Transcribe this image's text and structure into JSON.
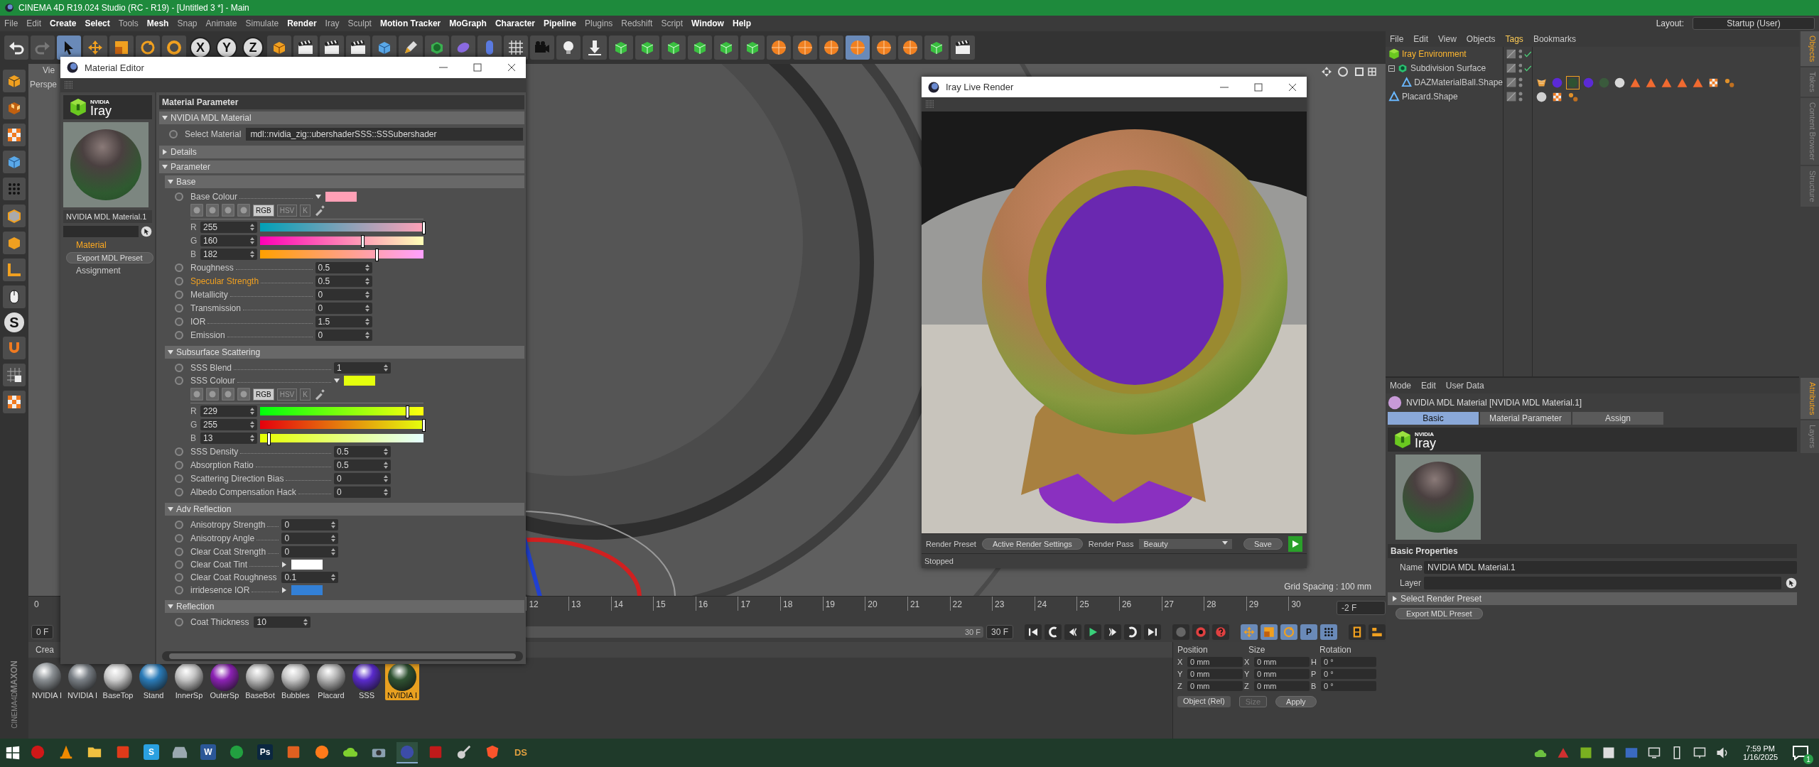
{
  "app": {
    "title": "CINEMA 4D R19.024 Studio (RC - R19) - [Untitled 3 *] - Main"
  },
  "menu": [
    {
      "label": "File",
      "emphasized": false
    },
    {
      "label": "Edit",
      "emphasized": false
    },
    {
      "label": "Create",
      "emphasized": true
    },
    {
      "label": "Select",
      "emphasized": true
    },
    {
      "label": "Tools",
      "emphasized": false
    },
    {
      "label": "Mesh",
      "emphasized": true
    },
    {
      "label": "Snap",
      "emphasized": false
    },
    {
      "label": "Animate",
      "emphasized": false
    },
    {
      "label": "Simulate",
      "emphasized": false
    },
    {
      "label": "Render",
      "emphasized": true
    },
    {
      "label": "Iray",
      "emphasized": false
    },
    {
      "label": "Sculpt",
      "emphasized": false
    },
    {
      "label": "Motion Tracker",
      "emphasized": true
    },
    {
      "label": "MoGraph",
      "emphasized": true
    },
    {
      "label": "Character",
      "emphasized": true
    },
    {
      "label": "Pipeline",
      "emphasized": true
    },
    {
      "label": "Plugins",
      "emphasized": false
    },
    {
      "label": "Redshift",
      "emphasized": false
    },
    {
      "label": "Script",
      "emphasized": false
    },
    {
      "label": "Window",
      "emphasized": true
    },
    {
      "label": "Help",
      "emphasized": true
    }
  ],
  "layout": {
    "label": "Layout:",
    "value": "Startup (User)"
  },
  "toolbar": [
    {
      "kind": "undo",
      "selected": false
    },
    {
      "kind": "redo",
      "selected": false
    },
    {
      "kind": "pointer",
      "selected": true
    },
    {
      "kind": "move",
      "selected": false
    },
    {
      "kind": "scale",
      "selected": false
    },
    {
      "kind": "rotate",
      "selected": false
    },
    {
      "kind": "live",
      "selected": false
    },
    {
      "kind": "axis",
      "label": "X",
      "selected": false
    },
    {
      "kind": "axis",
      "label": "Y",
      "selected": false
    },
    {
      "kind": "axis",
      "label": "Z",
      "selected": false
    },
    {
      "kind": "world",
      "selected": false
    },
    {
      "kind": "clapper",
      "selected": false
    },
    {
      "kind": "clapper",
      "selected": false
    },
    {
      "kind": "clapper",
      "selected": false
    },
    {
      "kind": "cube",
      "selected": false
    },
    {
      "kind": "pen",
      "selected": false
    },
    {
      "kind": "subdiv",
      "selected": false
    },
    {
      "kind": "deform",
      "selected": false
    },
    {
      "kind": "capsule",
      "selected": false
    },
    {
      "kind": "grid",
      "selected": false
    },
    {
      "kind": "camera",
      "selected": false
    },
    {
      "kind": "light",
      "selected": false
    },
    {
      "kind": "floor",
      "selected": false
    },
    {
      "kind": "greencube",
      "selected": false
    },
    {
      "kind": "greencube",
      "selected": false
    },
    {
      "kind": "greencube",
      "selected": false
    },
    {
      "kind": "greencube",
      "selected": false
    },
    {
      "kind": "greencube",
      "selected": false
    },
    {
      "kind": "greencube",
      "selected": false
    },
    {
      "kind": "orangesphere",
      "selected": false
    },
    {
      "kind": "orangesphere",
      "selected": false
    },
    {
      "kind": "orangesphere",
      "selected": false
    },
    {
      "kind": "orangesphere",
      "selected": true
    },
    {
      "kind": "orangesphere",
      "selected": false
    },
    {
      "kind": "orangesphere",
      "selected": false
    },
    {
      "kind": "greencube",
      "selected": false
    },
    {
      "kind": "clapper",
      "selected": false
    }
  ],
  "left_tools": [
    {
      "kind": "model"
    },
    {
      "kind": "texture"
    },
    {
      "kind": "checker"
    },
    {
      "kind": "cube"
    },
    {
      "kind": "points"
    },
    {
      "kind": "edges"
    },
    {
      "kind": "polys"
    },
    {
      "kind": "axis-l"
    },
    {
      "kind": "mouse"
    },
    {
      "kind": "letter",
      "label": "S"
    },
    {
      "kind": "magnet"
    },
    {
      "kind": "gridlock"
    },
    {
      "kind": "checker"
    }
  ],
  "brand_logo": [
    "MAXON",
    "CINEMA4D"
  ],
  "viewport": {
    "menu_text": "Vie",
    "camera": "Perspe",
    "grid_spacing": "Grid Spacing : 100 mm"
  },
  "timeline": {
    "first_tick": "0",
    "ticks": [
      "12",
      "13",
      "14",
      "15",
      "16",
      "17",
      "18",
      "19",
      "20",
      "21",
      "22",
      "23",
      "24",
      "25",
      "26",
      "27",
      "28",
      "29",
      "30"
    ],
    "current_frame": "-2 F",
    "start_field": "0 F",
    "range": {
      "end": "30 F",
      "level": 1
    },
    "end_field": "30 F"
  },
  "transport": [
    {
      "kind": "first"
    },
    {
      "kind": "prevkey"
    },
    {
      "kind": "prevframe"
    },
    {
      "kind": "play"
    },
    {
      "kind": "nextframe"
    },
    {
      "kind": "nextkey"
    },
    {
      "kind": "last"
    },
    {
      "kind": "recdisabled"
    },
    {
      "kind": "record"
    },
    {
      "kind": "help"
    },
    {
      "kind": "move"
    },
    {
      "kind": "scale"
    },
    {
      "kind": "rotate"
    },
    {
      "kind": "letter",
      "label": "P"
    },
    {
      "kind": "points"
    },
    {
      "kind": "film"
    },
    {
      "kind": "bars"
    }
  ],
  "material_manager": {
    "menu_text": "Crea",
    "materials": [
      {
        "name": "NVIDIA I",
        "color": "#8a8f93",
        "selected": false
      },
      {
        "name": "NVIDIA I",
        "color": "#7a8086",
        "selected": false
      },
      {
        "name": "BaseTop",
        "color": "#cfcfcf",
        "selected": false
      },
      {
        "name": "Stand",
        "color": "#2b7cb9",
        "selected": false
      },
      {
        "name": "InnerSp",
        "color": "#c4c4c4",
        "selected": false
      },
      {
        "name": "OuterSp",
        "color": "#8c22b4",
        "selected": false
      },
      {
        "name": "BaseBot",
        "color": "#bdbdbd",
        "selected": false
      },
      {
        "name": "Bubbles",
        "color": "#c9c9c9",
        "selected": false
      },
      {
        "name": "Placard",
        "color": "#b4b4b4",
        "selected": false
      },
      {
        "name": "SSS",
        "color": "#5a2bcc",
        "selected": false
      },
      {
        "name": "NVIDIA I",
        "color": "#2f5232",
        "selected": true
      }
    ]
  },
  "coordinates": {
    "headers": [
      "Position",
      "Size",
      "Rotation"
    ],
    "rows": [
      {
        "labels": [
          "X",
          "X",
          "H"
        ],
        "values": [
          "0 mm",
          "0 mm",
          "0 °"
        ]
      },
      {
        "labels": [
          "Y",
          "Y",
          "P"
        ],
        "values": [
          "0 mm",
          "0 mm",
          "0 °"
        ]
      },
      {
        "labels": [
          "Z",
          "Z",
          "B"
        ],
        "values": [
          "0 mm",
          "0 mm",
          "0 °"
        ]
      }
    ],
    "mode": "Object (Rel)",
    "size_mode": {
      "label": "Size",
      "disabled": true
    },
    "apply": "Apply"
  },
  "material_editor": {
    "title": "Material Editor",
    "logo": {
      "brand": "NVIDIA",
      "product": "Iray"
    },
    "material_name": "NVIDIA MDL Material.1",
    "channels": [
      {
        "label": "Material",
        "selected": true
      },
      {
        "label": "Export MDL Preset",
        "kind": "button"
      },
      {
        "label": "Assignment",
        "selected": false
      }
    ],
    "header": "Material Parameter",
    "groups": [
      {
        "title": "NVIDIA MDL Material",
        "expanded": true,
        "rows": [
          {
            "kind": "text",
            "label": "Select Material",
            "value": "mdl::nvidia_zig::ubershaderSSS::SSSubershader",
            "highlighted": false
          }
        ]
      },
      {
        "title": "Details",
        "expanded": false
      },
      {
        "title": "Parameter",
        "expanded": true,
        "subgroups": [
          {
            "title": "Base",
            "expanded": true,
            "rows": [
              {
                "kind": "color",
                "label": "Base Colour",
                "color": "#ffa0b6",
                "expanded": true,
                "highlighted": false,
                "modes": [
                  {
                    "label": "RGB",
                    "selected": true
                  },
                  {
                    "label": "HSV",
                    "selected": false
                  },
                  {
                    "label": "K",
                    "selected": false
                  }
                ],
                "channels": [
                  {
                    "name": "R",
                    "value": "255",
                    "level": 1
                  },
                  {
                    "name": "G",
                    "value": "160",
                    "level": 0.627
                  },
                  {
                    "name": "B",
                    "value": "182",
                    "level": 0.714
                  }
                ]
              },
              {
                "kind": "number",
                "label": "Roughness",
                "value": "0.5",
                "highlighted": false
              },
              {
                "kind": "number",
                "label": "Specular Strength",
                "value": "0.5",
                "highlighted": true
              },
              {
                "kind": "number",
                "label": "Metallicity",
                "value": "0",
                "highlighted": false
              },
              {
                "kind": "number",
                "label": "Transmission",
                "value": "0",
                "highlighted": false
              },
              {
                "kind": "number",
                "label": "IOR",
                "value": "1.5",
                "highlighted": false
              },
              {
                "kind": "number",
                "label": "Emission",
                "value": "0",
                "highlighted": false
              }
            ]
          },
          {
            "title": "Subsurface Scattering",
            "expanded": true,
            "rows": [
              {
                "kind": "number",
                "label": "SSS Blend",
                "value": "1",
                "highlighted": false
              },
              {
                "kind": "color",
                "label": "SSS Colour",
                "color": "#e5ff0d",
                "expanded": true,
                "highlighted": false,
                "modes": [
                  {
                    "label": "RGB",
                    "selected": true
                  },
                  {
                    "label": "HSV",
                    "selected": false
                  },
                  {
                    "label": "K",
                    "selected": false
                  }
                ],
                "channels": [
                  {
                    "name": "R",
                    "value": "229",
                    "level": 0.898
                  },
                  {
                    "name": "G",
                    "value": "255",
                    "level": 1
                  },
                  {
                    "name": "B",
                    "value": "13",
                    "level": 0.051
                  }
                ]
              },
              {
                "kind": "number",
                "label": "SSS Density",
                "value": "0.5",
                "highlighted": false
              },
              {
                "kind": "number",
                "label": "Absorption Ratio",
                "value": "0.5",
                "highlighted": false
              },
              {
                "kind": "number",
                "label": "Scattering Direction Bias",
                "value": "0",
                "highlighted": false
              },
              {
                "kind": "number",
                "label": "Albedo Compensation Hack",
                "value": "0",
                "highlighted": false
              }
            ]
          },
          {
            "title": "Adv Reflection",
            "expanded": true,
            "rows": [
              {
                "kind": "number",
                "label": "Anisotropy Strength",
                "value": "0",
                "highlighted": false
              },
              {
                "kind": "number",
                "label": "Anisotropy Angle",
                "value": "0",
                "highlighted": false
              },
              {
                "kind": "number",
                "label": "Clear Coat Strength",
                "value": "0",
                "highlighted": false
              },
              {
                "kind": "color",
                "label": "Clear Coat Tint",
                "color": "#ffffff",
                "expanded": false,
                "highlighted": false
              },
              {
                "kind": "number",
                "label": "Clear Coat Roughness",
                "value": "0.1",
                "highlighted": false
              },
              {
                "kind": "color",
                "label": "irridesence IOR",
                "color": "#3380d6",
                "expanded": false,
                "highlighted": false
              }
            ]
          },
          {
            "title": "Reflection",
            "expanded": true,
            "rows": [
              {
                "kind": "number",
                "label": "Coat Thickness",
                "value": "10",
                "highlighted": false
              }
            ]
          }
        ]
      }
    ]
  },
  "iray_render": {
    "title": "Iray Live Render",
    "preset_label": "Render Preset",
    "preset_button": "Active Render Settings",
    "pass_label": "Render Pass",
    "pass_value": "Beauty",
    "save": "Save",
    "status": "Stopped"
  },
  "object_manager": {
    "menu": [
      {
        "label": "File",
        "selected": false
      },
      {
        "label": "Edit",
        "selected": false
      },
      {
        "label": "View",
        "selected": false
      },
      {
        "label": "Objects",
        "selected": false
      },
      {
        "label": "Tags",
        "selected": true
      },
      {
        "label": "Bookmarks",
        "selected": false
      }
    ],
    "objects": [
      {
        "name": "Iray Environment",
        "kind": "environment",
        "selected": true,
        "enabled": true
      },
      {
        "name": "Subdivision Surface",
        "kind": "subdivision",
        "selected": false,
        "enabled": true,
        "expanded": true,
        "children": [
          {
            "name": "DAZMaterialBall.Shape",
            "kind": "shape",
            "selected": false,
            "enabled": false,
            "tags": [
              {
                "kind": "texture",
                "selected": false
              },
              {
                "kind": "ball",
                "color": "#5b2ad6",
                "selected": false
              },
              {
                "kind": "ball",
                "color": "#2f5232",
                "selected": true
              },
              {
                "kind": "ball",
                "color": "#5b2ad6",
                "selected": false
              },
              {
                "kind": "ball",
                "color": "#3a5a3c",
                "selected": false
              },
              {
                "kind": "ball",
                "color": "#d8d8d8",
                "selected": false
              },
              {
                "kind": "triangle",
                "selected": false
              },
              {
                "kind": "triangle",
                "selected": false
              },
              {
                "kind": "triangle",
                "selected": false
              },
              {
                "kind": "triangle",
                "selected": false
              },
              {
                "kind": "triangle",
                "selected": false
              },
              {
                "kind": "checker",
                "selected": false
              },
              {
                "kind": "dots",
                "selected": false
              }
            ]
          }
        ]
      },
      {
        "name": "Placard.Shape",
        "kind": "shape",
        "selected": false,
        "enabled": false,
        "tags": [
          {
            "kind": "ball",
            "color": "#d0d0d0",
            "selected": false
          },
          {
            "kind": "checker",
            "selected": false
          },
          {
            "kind": "dots",
            "selected": false
          }
        ]
      }
    ]
  },
  "attributes": {
    "menu": [
      "Mode",
      "Edit",
      "User Data"
    ],
    "header": "NVIDIA MDL Material [NVIDIA MDL Material.1]",
    "tabs": [
      {
        "label": "Basic",
        "selected": true
      },
      {
        "label": "Material Parameter",
        "selected": false
      },
      {
        "label": "Assign",
        "selected": false
      }
    ],
    "logo": {
      "brand": "NVIDIA",
      "product": "Iray"
    },
    "section": "Basic Properties",
    "fields": [
      {
        "label": "Name",
        "value": "NVIDIA MDL Material.1",
        "kind": "text"
      },
      {
        "label": "Layer",
        "kind": "link"
      }
    ],
    "preset_group": {
      "title": "Select Render Preset",
      "expanded": false
    },
    "export": "Export MDL Preset"
  },
  "side_tabs_top": [
    {
      "label": "Objects",
      "selected": true
    },
    {
      "label": "Takes",
      "selected": false
    },
    {
      "label": "Content Browser",
      "selected": false
    },
    {
      "label": "Structure",
      "selected": false
    }
  ],
  "side_tabs_bottom": [
    {
      "label": "Attributes",
      "selected": true
    },
    {
      "label": "Layers",
      "selected": false
    }
  ],
  "taskbar": {
    "apps": [
      {
        "kind": "circle",
        "color": "#d01818",
        "active": false
      },
      {
        "kind": "cone",
        "color": "#f08a00",
        "active": false
      },
      {
        "kind": "folder",
        "color": "#f0c040",
        "active": false
      },
      {
        "kind": "square",
        "color": "#e03a1a",
        "active": false
      },
      {
        "kind": "letter",
        "label": "S",
        "color": "#2aa0e0",
        "active": false
      },
      {
        "kind": "car",
        "color": "#9aa8b0",
        "active": false
      },
      {
        "kind": "letter",
        "label": "W",
        "color": "#2b5797",
        "active": false
      },
      {
        "kind": "circle",
        "color": "#22a040",
        "active": false
      },
      {
        "kind": "letter",
        "label": "Ps",
        "color": "#0b2740",
        "active": false
      },
      {
        "kind": "square",
        "color": "#e06020",
        "active": false
      },
      {
        "kind": "circle",
        "color": "#ff7a1a",
        "active": false
      },
      {
        "kind": "cloud",
        "color": "#7fcf2f",
        "active": false
      },
      {
        "kind": "camera",
        "color": "#8aa0b0",
        "active": false
      },
      {
        "kind": "circle",
        "color": "#3c4ca8",
        "active": true
      },
      {
        "kind": "square",
        "color": "#c01a1a",
        "active": false
      },
      {
        "kind": "guitar",
        "color": "#d0d0d0",
        "active": false
      },
      {
        "kind": "shield",
        "color": "#fb542b",
        "active": false
      },
      {
        "kind": "text",
        "label": "DS",
        "color": "#e0a040",
        "active": false
      }
    ],
    "time": "7:59 PM",
    "date": "1/16/2025",
    "notifications": "1"
  }
}
